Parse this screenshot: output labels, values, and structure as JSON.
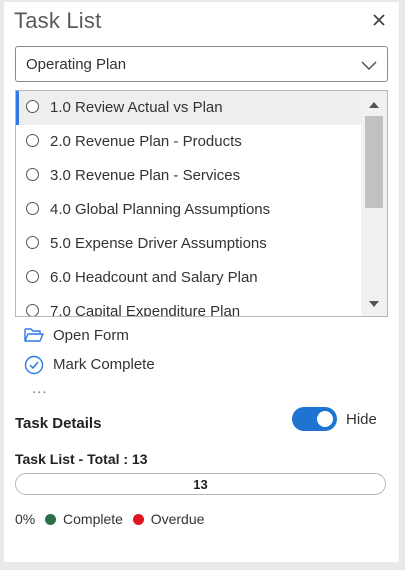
{
  "header": {
    "title": "Task List"
  },
  "colors": {
    "accent": "#1f73d1",
    "complete": "#2a6e45",
    "overdue": "#e0141e",
    "selected_bg": "#eeeeee"
  },
  "dropdown": {
    "value": "Operating Plan"
  },
  "tasks": {
    "items": [
      {
        "label": "1.0 Review Actual vs Plan",
        "selected": true
      },
      {
        "label": "2.0 Revenue Plan - Products"
      },
      {
        "label": "3.0 Revenue Plan - Services"
      },
      {
        "label": "4.0 Global Planning Assumptions"
      },
      {
        "label": "5.0 Expense Driver Assumptions"
      },
      {
        "label": "6.0 Headcount and Salary Plan"
      },
      {
        "label": "7.0 Capital Expenditure Plan"
      }
    ]
  },
  "actions": {
    "open_form": "Open Form",
    "mark_complete": "Mark Complete",
    "more": "..."
  },
  "details": {
    "label": "Task Details",
    "toggle_on": true,
    "toggle_label": "Hide"
  },
  "summary": {
    "total_label": "Task List - Total : 13",
    "progress_text": "13",
    "progress_fraction": 0,
    "percent": "0%",
    "complete_label": "Complete",
    "overdue_label": "Overdue"
  }
}
